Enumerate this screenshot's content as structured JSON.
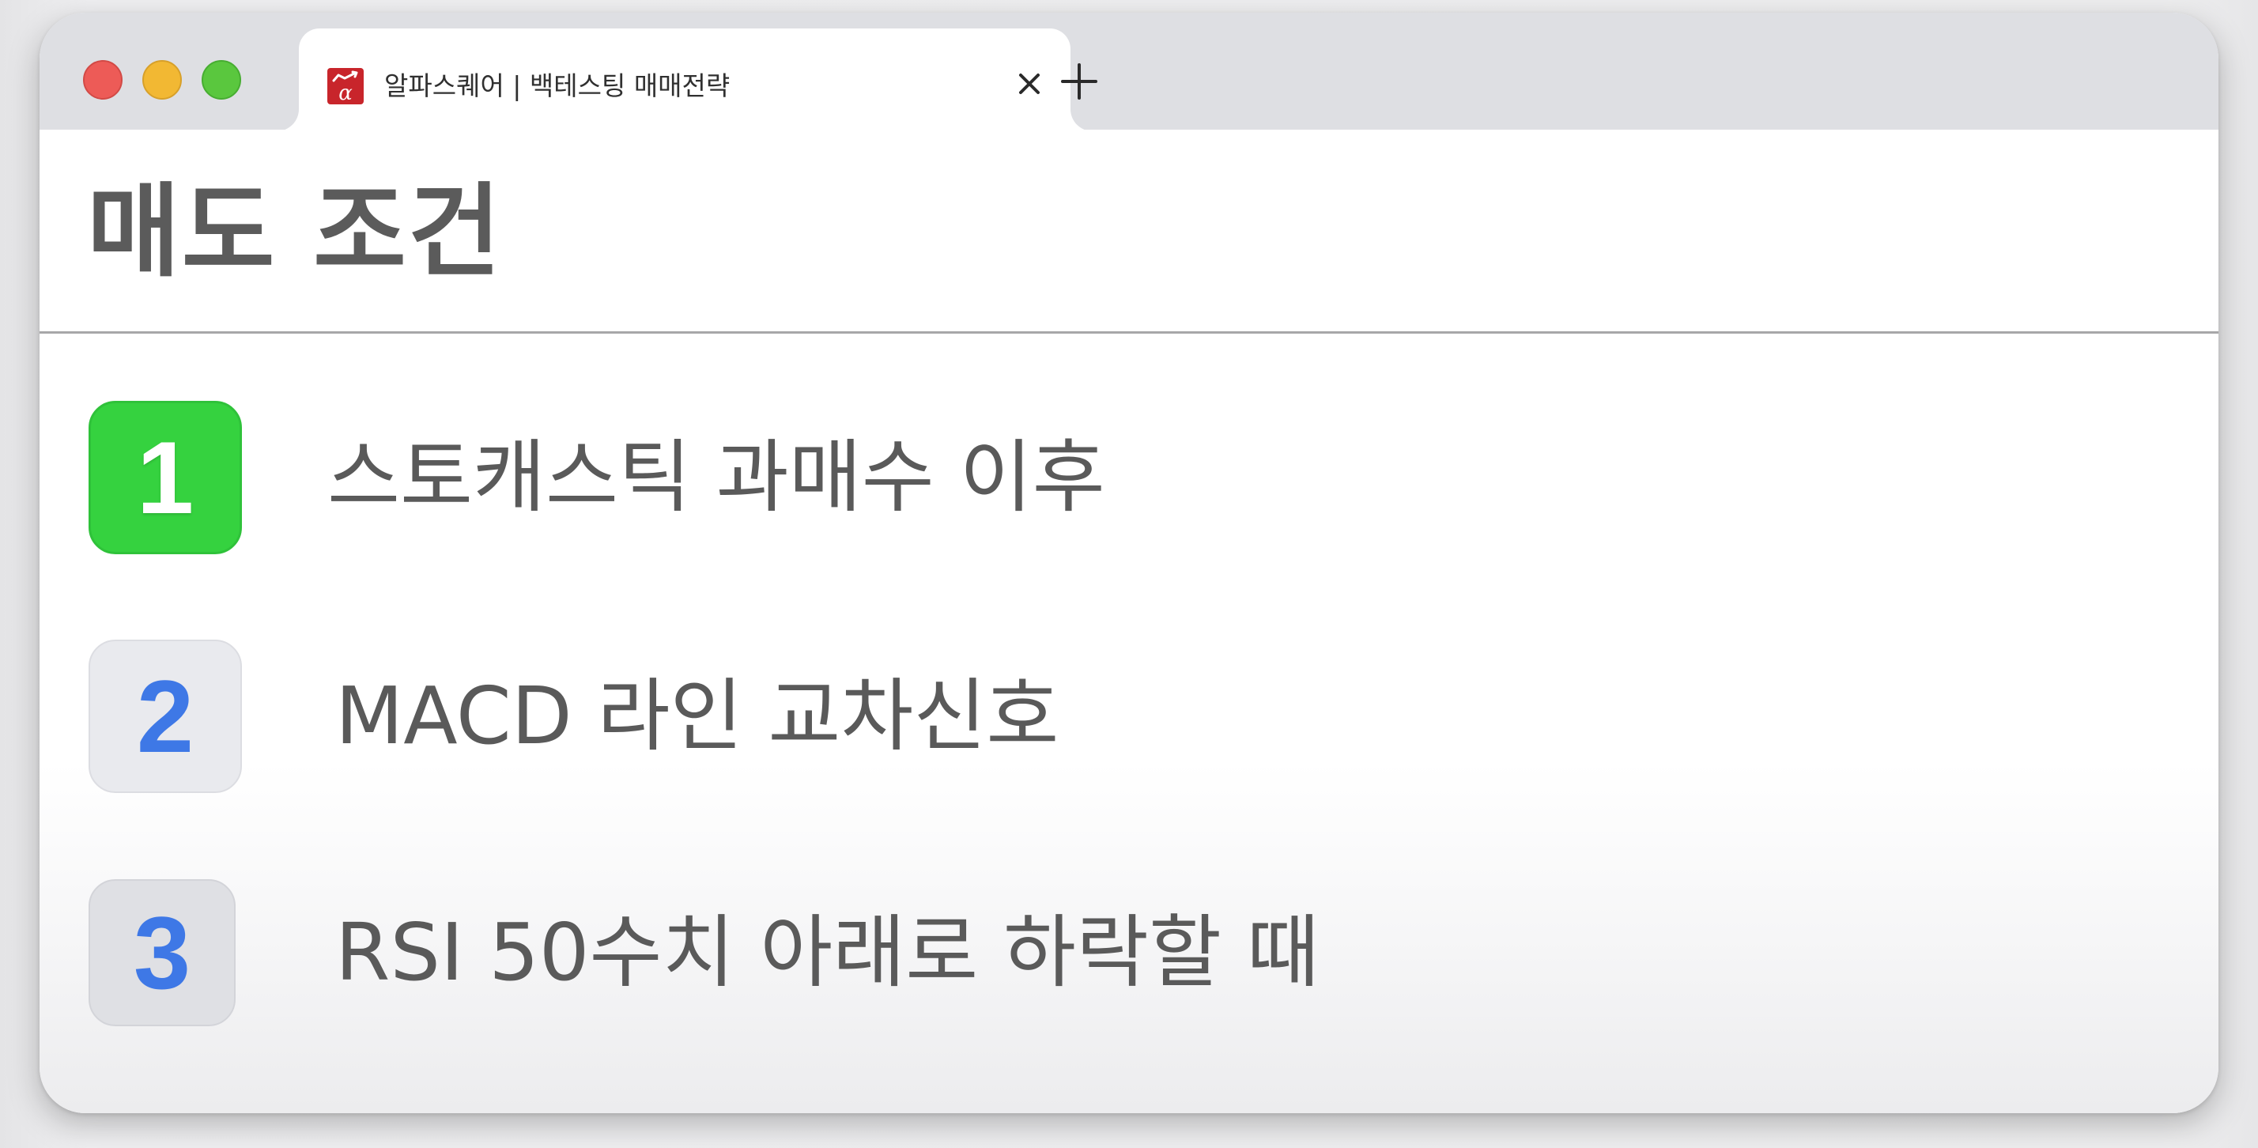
{
  "browser": {
    "tab": {
      "title": "알파스퀘어 | 백테스팅 매매전략",
      "favicon": "alphasquare-logo-icon"
    },
    "close_icon": "close-icon",
    "new_tab_icon": "plus-icon"
  },
  "page": {
    "title": "매도 조건",
    "items": [
      {
        "number": "1",
        "label": "스토캐스틱 과매수 이후",
        "badge_color": "#35d23f"
      },
      {
        "number": "2",
        "label": "MACD 라인 교차신호",
        "badge_color": "#e9eaee"
      },
      {
        "number": "3",
        "label": "RSI 50수치 아래로 하락할 때",
        "badge_color": "#dfe0e4"
      }
    ]
  },
  "colors": {
    "accent_green": "#35d23f",
    "number_blue": "#3e78e6",
    "favicon_red": "#c8252b"
  }
}
